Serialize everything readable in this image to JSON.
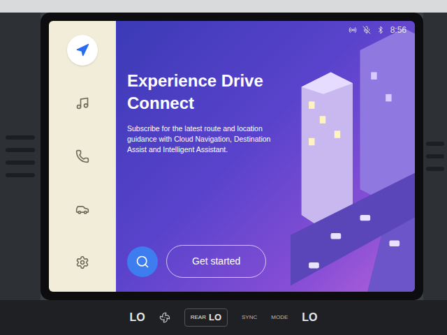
{
  "screen": {
    "title": "Experience Drive Connect",
    "description": "Subscribe for the latest route and location guidance with Cloud Navigation, Destination Assist and Intelligent Assistant.",
    "button": "Get started"
  },
  "status_bar": {
    "time": "8:56"
  },
  "sidebar": {
    "items": [
      {
        "kind": "navigation",
        "selected": true
      },
      {
        "kind": "music",
        "selected": false
      },
      {
        "kind": "phone",
        "selected": false
      },
      {
        "kind": "car",
        "selected": false
      },
      {
        "kind": "settings",
        "selected": false
      }
    ]
  },
  "climate": {
    "left": "LO",
    "rear_label": "REAR",
    "rear": "LO",
    "right": "LO",
    "buttons": [
      "SYNC",
      "MODE"
    ]
  }
}
